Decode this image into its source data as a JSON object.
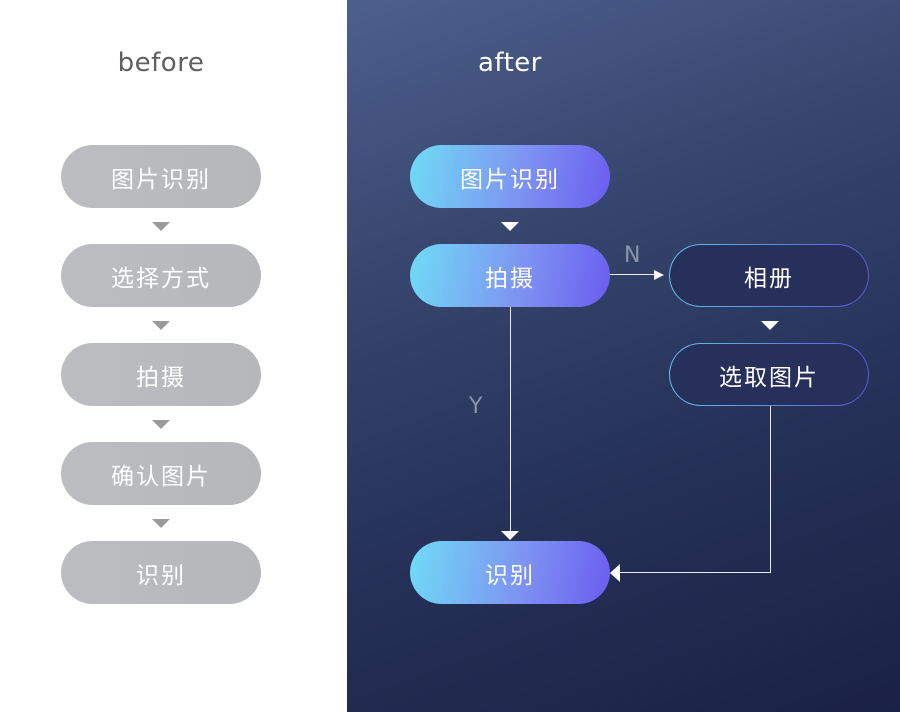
{
  "before": {
    "heading": "before",
    "steps": [
      {
        "label": "图片识别"
      },
      {
        "label": "选择方式"
      },
      {
        "label": "拍摄"
      },
      {
        "label": "确认图片"
      },
      {
        "label": "识别"
      }
    ]
  },
  "after": {
    "heading": "after",
    "nodes": {
      "recognize_image": "图片识别",
      "capture": "拍摄",
      "album": "相册",
      "select_image": "选取图片",
      "recognize": "识别"
    },
    "branch_labels": {
      "no": "N",
      "yes": "Y"
    }
  },
  "colors": {
    "gray_pill": "#b9babd",
    "gradient_start": "#6fdcf6",
    "gradient_end": "#6a5df0",
    "panel_dark": "#1a2145",
    "panel_light": "#4d5f8c"
  }
}
